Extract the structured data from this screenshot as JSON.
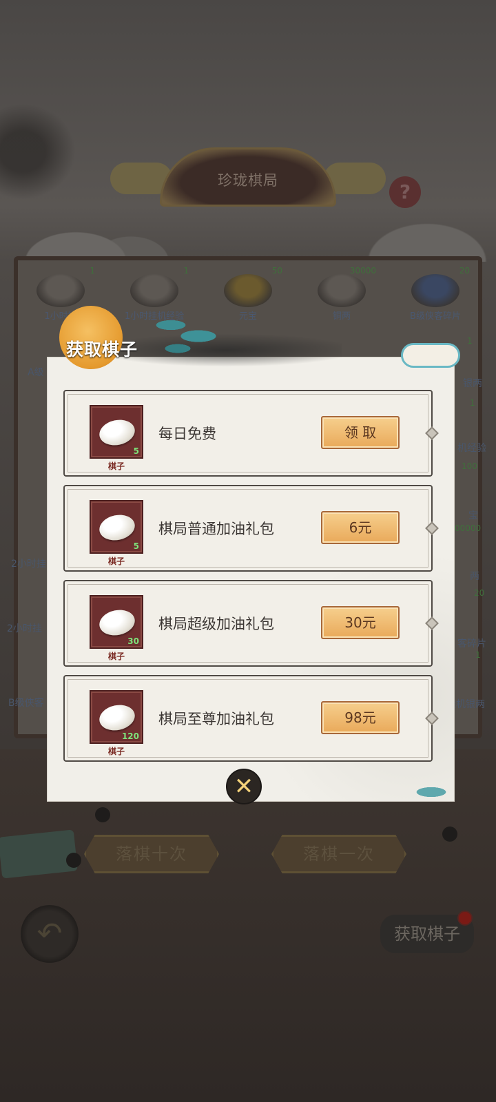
{
  "title": "珍珑棋局",
  "help_glyph": "?",
  "board_rewards_row1": [
    {
      "count": "1",
      "name": "1小时挂"
    },
    {
      "count": "1",
      "name": "1小时挂机经验"
    },
    {
      "count": "50",
      "name": "元宝"
    },
    {
      "count": "30000",
      "name": "铜两"
    },
    {
      "count": "20",
      "name": "B级侠客碎片"
    }
  ],
  "board_side_labels": {
    "l1": "A级",
    "l2": "2小时挂",
    "l3": "2小时挂",
    "l4": "B级侠客",
    "r1": "银两",
    "r2": "机经验",
    "r3": "宝",
    "r4": "两",
    "r5": "客碎片",
    "r6": "挂机银两",
    "r_counts": [
      "1",
      "1",
      "100",
      "00000",
      "20",
      "1"
    ]
  },
  "drop_buttons": {
    "ten": "落棋十次",
    "one": "落棋一次"
  },
  "back_glyph": "↶",
  "get_pieces_button": "获取棋子",
  "dialog": {
    "title": "获取棋子",
    "close_glyph": "✕",
    "rows": [
      {
        "item_label": "棋子",
        "qty": "5",
        "name": "每日免费",
        "button": "领 取"
      },
      {
        "item_label": "棋子",
        "qty": "5",
        "name": "棋局普通加油礼包",
        "button": "6元"
      },
      {
        "item_label": "棋子",
        "qty": "30",
        "name": "棋局超级加油礼包",
        "button": "30元"
      },
      {
        "item_label": "棋子",
        "qty": "120",
        "name": "棋局至尊加油礼包",
        "button": "98元"
      }
    ]
  }
}
